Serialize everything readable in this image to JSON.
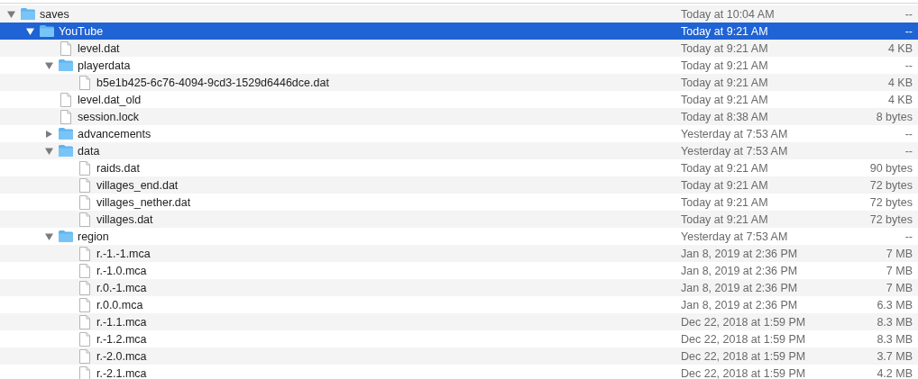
{
  "files": [
    {
      "name": "saves",
      "kind": "folder",
      "expanded": true,
      "selected": false,
      "modified": "Today at 10:04 AM",
      "size": "--",
      "children": [
        {
          "name": "YouTube",
          "kind": "folder",
          "expanded": true,
          "selected": true,
          "modified": "Today at 9:21 AM",
          "size": "--",
          "children": [
            {
              "name": "level.dat",
              "kind": "file",
              "selected": false,
              "modified": "Today at 9:21 AM",
              "size": "4 KB"
            },
            {
              "name": "playerdata",
              "kind": "folder",
              "expanded": true,
              "selected": false,
              "modified": "Today at 9:21 AM",
              "size": "--",
              "children": [
                {
                  "name": "b5e1b425-6c76-4094-9cd3-1529d6446dce.dat",
                  "kind": "file",
                  "selected": false,
                  "modified": "Today at 9:21 AM",
                  "size": "4 KB"
                }
              ]
            },
            {
              "name": "level.dat_old",
              "kind": "file",
              "selected": false,
              "modified": "Today at 9:21 AM",
              "size": "4 KB"
            },
            {
              "name": "session.lock",
              "kind": "file",
              "selected": false,
              "modified": "Today at 8:38 AM",
              "size": "8 bytes"
            },
            {
              "name": "advancements",
              "kind": "folder",
              "expanded": false,
              "selected": false,
              "modified": "Yesterday at 7:53 AM",
              "size": "--"
            },
            {
              "name": "data",
              "kind": "folder",
              "expanded": true,
              "selected": false,
              "modified": "Yesterday at 7:53 AM",
              "size": "--",
              "children": [
                {
                  "name": "raids.dat",
                  "kind": "file",
                  "selected": false,
                  "modified": "Today at 9:21 AM",
                  "size": "90 bytes"
                },
                {
                  "name": "villages_end.dat",
                  "kind": "file",
                  "selected": false,
                  "modified": "Today at 9:21 AM",
                  "size": "72 bytes"
                },
                {
                  "name": "villages_nether.dat",
                  "kind": "file",
                  "selected": false,
                  "modified": "Today at 9:21 AM",
                  "size": "72 bytes"
                },
                {
                  "name": "villages.dat",
                  "kind": "file",
                  "selected": false,
                  "modified": "Today at 9:21 AM",
                  "size": "72 bytes"
                }
              ]
            },
            {
              "name": "region",
              "kind": "folder",
              "expanded": true,
              "selected": false,
              "modified": "Yesterday at 7:53 AM",
              "size": "--",
              "children": [
                {
                  "name": "r.-1.-1.mca",
                  "kind": "file",
                  "selected": false,
                  "modified": "Jan 8, 2019 at 2:36 PM",
                  "size": "7 MB"
                },
                {
                  "name": "r.-1.0.mca",
                  "kind": "file",
                  "selected": false,
                  "modified": "Jan 8, 2019 at 2:36 PM",
                  "size": "7 MB"
                },
                {
                  "name": "r.0.-1.mca",
                  "kind": "file",
                  "selected": false,
                  "modified": "Jan 8, 2019 at 2:36 PM",
                  "size": "7 MB"
                },
                {
                  "name": "r.0.0.mca",
                  "kind": "file",
                  "selected": false,
                  "modified": "Jan 8, 2019 at 2:36 PM",
                  "size": "6.3 MB"
                },
                {
                  "name": "r.-1.1.mca",
                  "kind": "file",
                  "selected": false,
                  "modified": "Dec 22, 2018 at 1:59 PM",
                  "size": "8.3 MB"
                },
                {
                  "name": "r.-1.2.mca",
                  "kind": "file",
                  "selected": false,
                  "modified": "Dec 22, 2018 at 1:59 PM",
                  "size": "8.3 MB"
                },
                {
                  "name": "r.-2.0.mca",
                  "kind": "file",
                  "selected": false,
                  "modified": "Dec 22, 2018 at 1:59 PM",
                  "size": "3.7 MB"
                },
                {
                  "name": "r.-2.1.mca",
                  "kind": "file",
                  "selected": false,
                  "modified": "Dec 22, 2018 at 1:59 PM",
                  "size": "4.2 MB"
                }
              ]
            }
          ]
        }
      ]
    }
  ]
}
